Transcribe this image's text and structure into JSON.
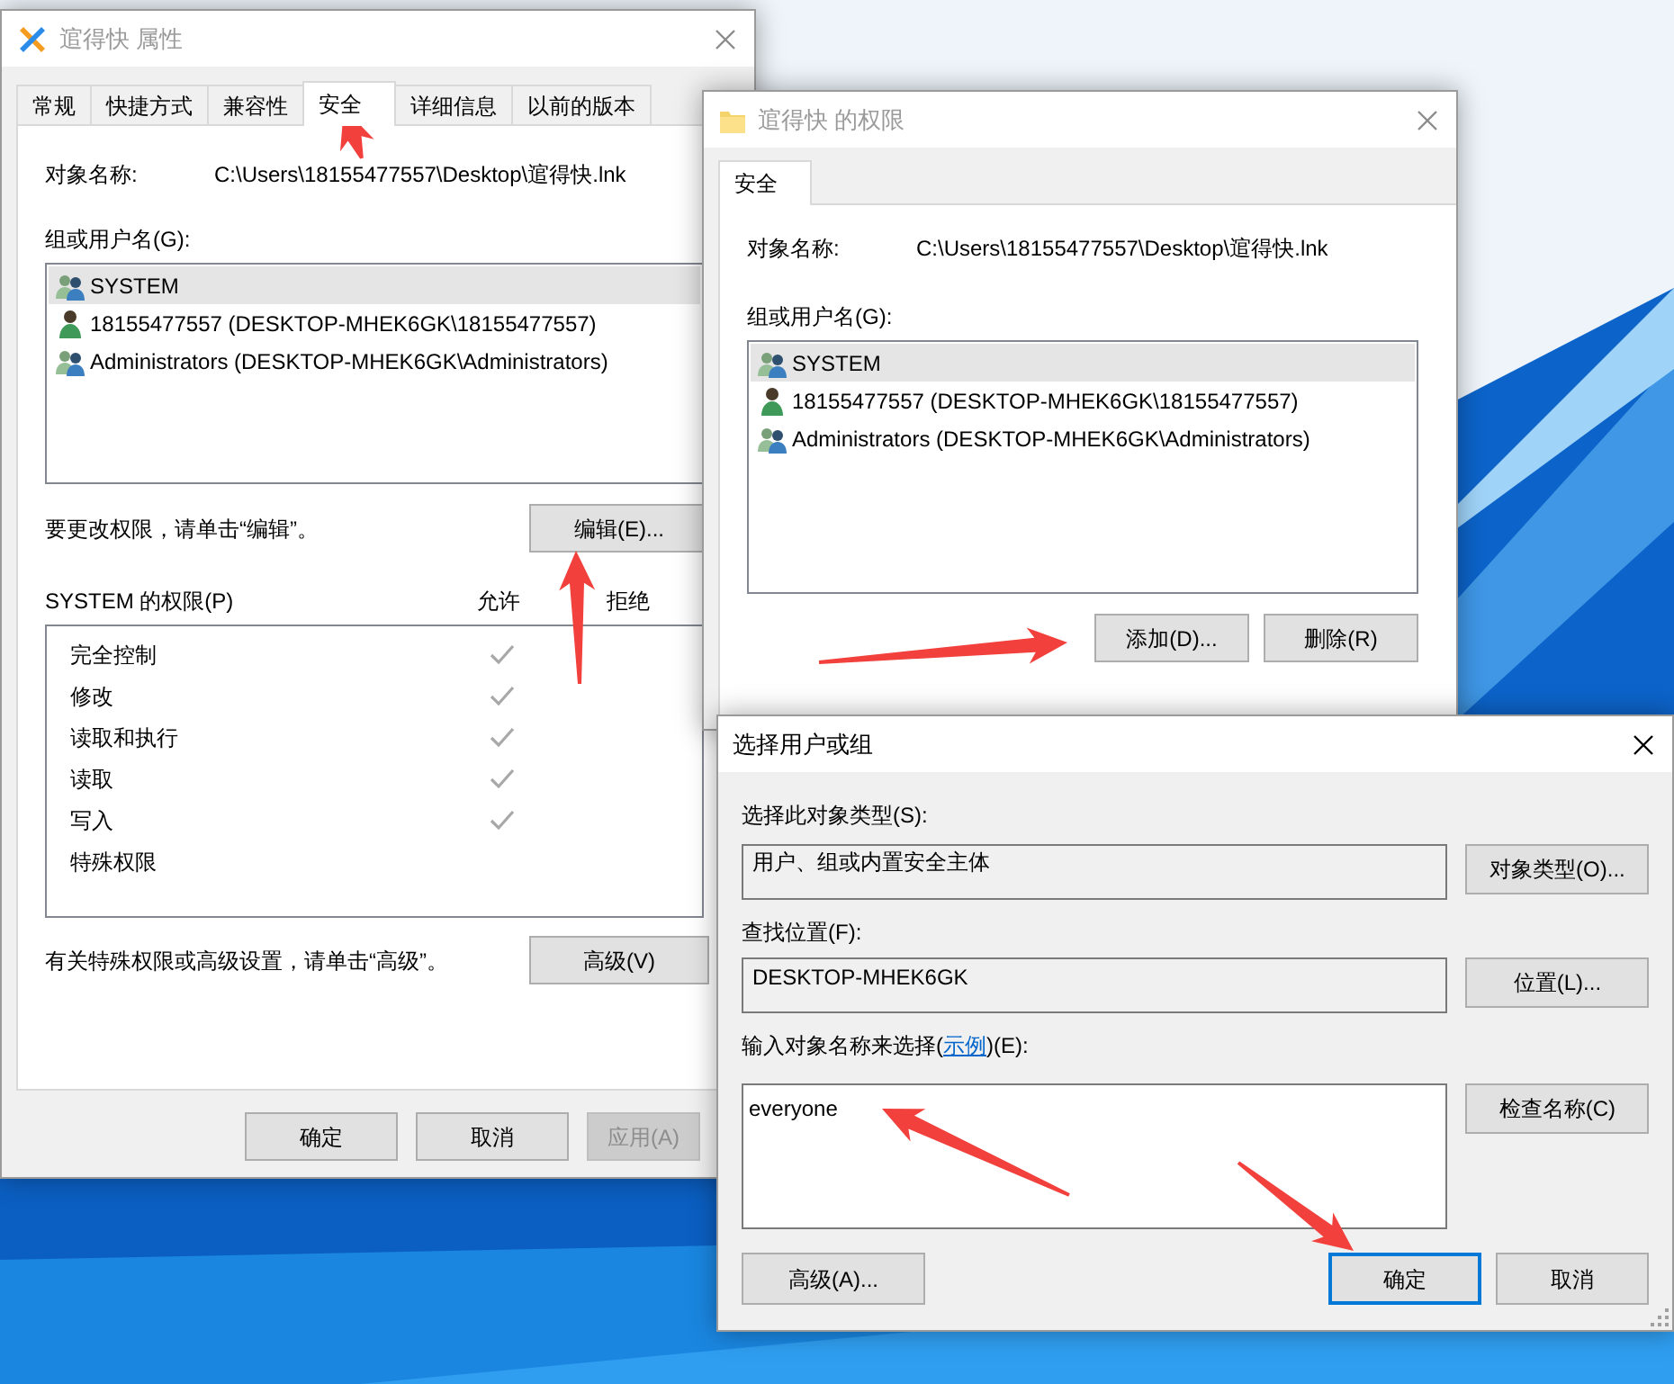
{
  "windows": [
    {
      "kind": "properties",
      "active": false,
      "title": "逭得快 属性",
      "tabs": [
        {
          "label": "常规",
          "selected": false
        },
        {
          "label": "快捷方式",
          "selected": false
        },
        {
          "label": "兼容性",
          "selected": false
        },
        {
          "label": "安全",
          "selected": true
        },
        {
          "label": "详细信息",
          "selected": false
        },
        {
          "label": "以前的版本",
          "selected": false
        }
      ],
      "object_label": "对象名称:",
      "object_path": "C:\\Users\\18155477557\\Desktop\\逭得快.lnk",
      "groups_label": "组或用户名(G):",
      "principals": [
        {
          "kind": "group",
          "name": "SYSTEM",
          "selected": true
        },
        {
          "kind": "user",
          "name": "18155477557 (DESKTOP-MHEK6GK\\18155477557)",
          "selected": false
        },
        {
          "kind": "group",
          "name": "Administrators (DESKTOP-MHEK6GK\\Administrators)",
          "selected": false
        }
      ],
      "edit_hint": "要更改权限，请单击“编辑”。",
      "edit_button": "编辑(E)...",
      "permissions_label": "SYSTEM 的权限(P)",
      "allow_label": "允许",
      "deny_label": "拒绝",
      "permissions": [
        {
          "name": "完全控制",
          "allow": true,
          "deny": false
        },
        {
          "name": "修改",
          "allow": true,
          "deny": false
        },
        {
          "name": "读取和执行",
          "allow": true,
          "deny": false
        },
        {
          "name": "读取",
          "allow": true,
          "deny": false
        },
        {
          "name": "写入",
          "allow": true,
          "deny": false
        },
        {
          "name": "特殊权限",
          "allow": false,
          "deny": false
        }
      ],
      "advanced_hint": "有关特殊权限或高级设置，请单击“高级”。",
      "advanced_button": "高级(V)",
      "buttons": [
        {
          "label": "确定",
          "disabled": false
        },
        {
          "label": "取消",
          "disabled": false
        },
        {
          "label": "应用(A)",
          "disabled": true
        }
      ]
    },
    {
      "kind": "permissions",
      "active": false,
      "title": "逭得快 的权限",
      "tabs": [
        {
          "label": "安全",
          "selected": true
        }
      ],
      "object_label": "对象名称:",
      "object_path": "C:\\Users\\18155477557\\Desktop\\逭得快.lnk",
      "groups_label": "组或用户名(G):",
      "principals": [
        {
          "kind": "group",
          "name": "SYSTEM",
          "selected": true
        },
        {
          "kind": "user",
          "name": "18155477557 (DESKTOP-MHEK6GK\\18155477557)",
          "selected": false
        },
        {
          "kind": "group",
          "name": "Administrators (DESKTOP-MHEK6GK\\Administrators)",
          "selected": false
        }
      ],
      "buttons": [
        {
          "label": "添加(D)...",
          "disabled": false
        },
        {
          "label": "删除(R)",
          "disabled": false
        }
      ]
    },
    {
      "kind": "select_user",
      "active": true,
      "title": "选择用户或组",
      "type_label": "选择此对象类型(S):",
      "type_value": "用户、组或内置安全主体",
      "type_button": "对象类型(O)...",
      "location_label": "查找位置(F):",
      "location_value": "DESKTOP-MHEK6GK",
      "location_button": "位置(L)...",
      "names_label_before": "输入对象名称来选择(",
      "names_link": "示例",
      "names_label_after": ")(E):",
      "names_value": "everyone",
      "check_button": "检查名称(C)",
      "buttons": [
        {
          "label": "高级(A)...",
          "default": false
        },
        {
          "label": "确定",
          "default": true
        },
        {
          "label": "取消",
          "default": false
        }
      ]
    }
  ],
  "annotations": [
    {
      "kind": "arrow"
    },
    {
      "kind": "arrow"
    },
    {
      "kind": "arrow"
    },
    {
      "kind": "arrow"
    },
    {
      "kind": "arrow"
    }
  ]
}
